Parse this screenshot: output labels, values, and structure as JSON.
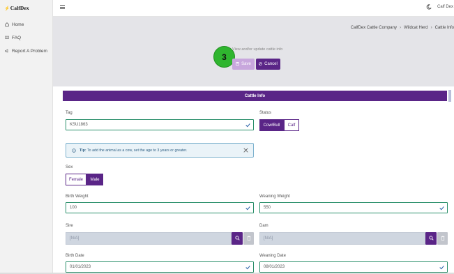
{
  "app": {
    "brand": "CalfDex",
    "user": "Calf Dex"
  },
  "sidebar": {
    "items": [
      {
        "label": "Home",
        "icon": "home-icon"
      },
      {
        "label": "FAQ",
        "icon": "book-icon"
      },
      {
        "label": "Report A Problem",
        "icon": "megaphone-icon"
      }
    ]
  },
  "breadcrumb": [
    "CalfDex Cattle Company",
    "Wildcat Herd",
    "Cattle Info"
  ],
  "header": {
    "step_marker": "3",
    "subtitle": "View and/or update cattle info",
    "save_label": "Save",
    "cancel_label": "Cancel"
  },
  "card": {
    "title": "Cattle Info"
  },
  "form": {
    "tag": {
      "label": "Tag",
      "value": "KSU1863"
    },
    "status": {
      "label": "Status",
      "options": [
        "Cow/Bull",
        "Calf"
      ],
      "selected": "Cow/Bull"
    },
    "tip": {
      "prefix": "Tip:",
      "text": "To add the animal as a cow, set the age to 3 years or greater."
    },
    "sex": {
      "label": "Sex",
      "options": [
        "Female",
        "Male"
      ],
      "selected": "Male"
    },
    "birth_weight": {
      "label": "Birth Weight",
      "value": "100"
    },
    "weaning_weight": {
      "label": "Weaning Weight",
      "value": "550"
    },
    "sire": {
      "label": "Sire",
      "value": "[N/A]"
    },
    "dam": {
      "label": "Dam",
      "value": "[N/A]"
    },
    "birth_date": {
      "label": "Birth Date",
      "value": "01/01/2023"
    },
    "weaning_date": {
      "label": "Weaning Date",
      "value": "08/01/2023"
    }
  },
  "colors": {
    "primary": "#5a2587",
    "primary_light": "#c8a7dd",
    "valid_border": "#2a8f6a",
    "step_marker": "#2fb52f"
  }
}
